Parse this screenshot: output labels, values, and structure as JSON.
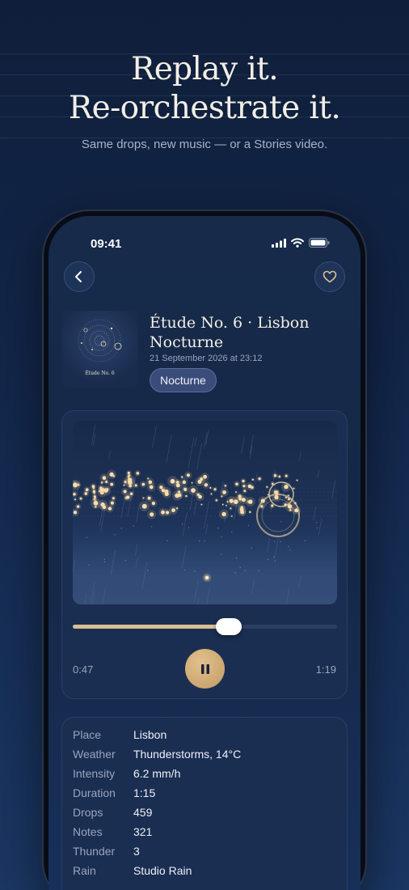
{
  "headline": {
    "line1": "Replay it.",
    "line2": "Re-orchestrate it."
  },
  "subline": "Same drops, new music — or a Stories video.",
  "status_bar": {
    "time": "09:41"
  },
  "track": {
    "cover_title": "Étude No. 6",
    "title": "Étude No. 6 · Lisbon Nocturne",
    "date": "21 September 2026 at 23:12",
    "tag": "Nocturne"
  },
  "player": {
    "current_time": "0:47",
    "total_time": "1:19",
    "progress": 0.59,
    "state": "playing"
  },
  "details": [
    {
      "label": "Place",
      "value": "Lisbon"
    },
    {
      "label": "Weather",
      "value": "Thunderstorms, 14°C"
    },
    {
      "label": "Intensity",
      "value": "6.2 mm/h"
    },
    {
      "label": "Duration",
      "value": "1:15"
    },
    {
      "label": "Drops",
      "value": "459"
    },
    {
      "label": "Notes",
      "value": "321"
    },
    {
      "label": "Thunder",
      "value": "3"
    },
    {
      "label": "Rain",
      "value": "Studio Rain"
    }
  ],
  "colors": {
    "accent_gold": "#d9bf92",
    "background": "#12264a",
    "card": "#1a2e52"
  },
  "icons": {
    "back": "chevron-left-icon",
    "favorite": "heart-icon",
    "play_state": "pause-icon"
  }
}
